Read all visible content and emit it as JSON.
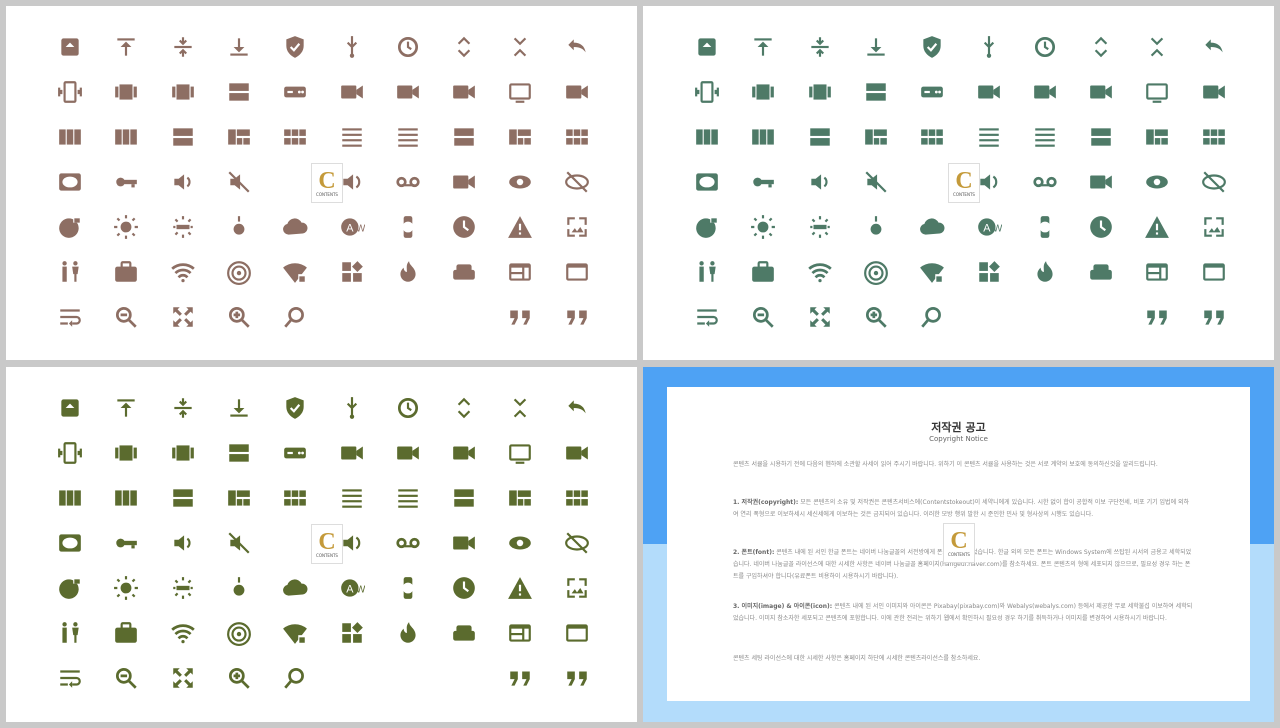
{
  "palettes": {
    "panel_1": "#8d6e63",
    "panel_2": "#4e7a67",
    "panel_3": "#5b6b2e"
  },
  "watermark": {
    "letter": "C",
    "text": "CONTENTS"
  },
  "icon_rows": [
    [
      "archive-icon",
      "vertical-align-top-icon",
      "vertical-align-center-icon",
      "vertical-align-bottom-icon",
      "verified-shield-icon",
      "usb-icon",
      "update-icon",
      "unfold-more-icon",
      "unfold-less-icon",
      "undo-icon"
    ],
    [
      "vibration-icon",
      "view-array-icon",
      "view-carousel-icon",
      "view-agenda-icon",
      "gamepad-icon",
      "videocam-icon",
      "videocam-off-icon",
      "video-library-icon",
      "tablet-icon",
      "video-call-icon"
    ],
    [
      "view-week-icon",
      "view-column-icon",
      "view-stream-icon",
      "view-quilt-icon",
      "view-module-icon",
      "view-list-icon",
      "view-headline-icon",
      "view-day-icon",
      "view-compact-icon",
      "view-comfy-icon"
    ],
    [
      "vignette-icon",
      "vpn-key-icon",
      "volume-down-icon",
      "volume-off-icon",
      "",
      "volume-up-icon",
      "voicemail-icon",
      "video-chat-icon",
      "visibility-icon",
      "visibility-off-icon"
    ],
    [
      "vpn-lock-icon",
      "brightness-high-icon",
      "brightness-medium-icon",
      "brightness-low-icon",
      "cloud-icon",
      "wallpaper-text-icon",
      "watch-icon",
      "watch-later-icon",
      "warning-icon",
      "wallpaper-icon"
    ],
    [
      "wc-icon",
      "work-icon",
      "wifi-icon",
      "wifi-tethering-icon",
      "wifi-lock-icon",
      "widgets-icon",
      "whatshot-icon",
      "weekend-icon",
      "web-icon",
      "web-asset-icon"
    ],
    [
      "wrap-text-icon",
      "zoom-out-icon",
      "zoom-out-map-icon",
      "zoom-in-icon",
      "zoom-search-icon",
      "",
      "",
      "",
      "format-quote-left-icon",
      "format-quote-icon"
    ]
  ],
  "notice": {
    "title": "저작권 공고",
    "subtitle": "Copyright Notice",
    "intro": "콘텐츠 서큘을 시용하기 전에 다음의 헨하에 소관할 사세이 읽어 주시기 바랍니다. 위하기 이 콘텐츠 서큘을 사용하는 것은 서로 계약의 보호에 동의하신것을 알리드립니다.",
    "s1_head": "1. 저작권(copyright):",
    "s1_body": "모든 콘텐츠의 소유 및 저작권은 콘텐츠서비스에(Contentstokeout)이 세약니에게 있습니다. 시한 없이 합이 공합적 이보 구단전세, 비포 기기 임법에 외하여 연리 폭형으로 이보하세시 세신세에게 이보하는 것은 금지되어 있습니다. 이러한 모방 행위 발한 시 준인한 민사 및 형사상의 시행도 있습니다.",
    "s2_head": "2. 폰트(font):",
    "s2_body": "콘텐츠 내에 된 서인 한글 폰트는 네이버 나눔글꼴의 서전방에게 폰트이 세학되었습니다. 한글 외의 모든 폰트는 Windows System에 쓰탑된 시서의 금용고 세학되었습니다. 네이버 나눔글꼴 라이선스에 대한 시세한 사항은 네이버 나눔글꼴 홈페이지(hangeul.naver.com)를 참소하세요. 폰트 콘텐츠의 형에 세포되지 않으므로, 필요성 경우 하는 폰트를 구입하셔야 합니다(유료폰트 비용하이 시용하시기 바랍니다).",
    "s3_head": "3. 이미지(image) & 아이콘(icon):",
    "s3_body": "콘텐츠 내에 된 서인 이미지와 아이콘은 Pixabay(pixabay.com)와 Webalys(webalys.com) 등에서 제공한 무료 세학불섭 이보하여 세학되었습니다. 이미지 참소자한 세포되고 콘텐츠에 포함합니다. 이에 관한 전리는 위하기 웹에서 확인하시 필요성 경우 하기를 취득하거나 이미지를 변경하여 시용하시기 바랍니다.",
    "outro": "콘텐츠 세팅 라이선스에 대한 시세한 사항은 홈페이지 하단에 시세한 콘텐츠라이선스를 참소하세요."
  }
}
